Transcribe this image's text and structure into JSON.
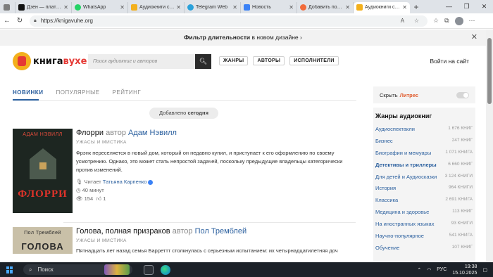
{
  "browser": {
    "tabs": [
      {
        "label": "",
        "color": "#7d7d7d",
        "active": false
      },
      {
        "label": "Дзен — платф...",
        "color": "#111111",
        "active": false
      },
      {
        "label": "WhatsApp",
        "color": "#25d366",
        "active": false
      },
      {
        "label": "Аудиокниги сл...",
        "color": "#f3b01c",
        "active": false
      },
      {
        "label": "Telegram Web",
        "color": "#2aa1da",
        "active": false
      },
      {
        "label": "Новость",
        "color": "#3b82f6",
        "active": false
      },
      {
        "label": "Добавить пост...",
        "color": "#f26b3a",
        "active": false
      },
      {
        "label": "Аудиокниги сл...",
        "color": "#f3b01c",
        "active": true
      }
    ],
    "url": "https://knigavuhe.org",
    "new_tab": "+",
    "window_controls": {
      "minimize": "—",
      "maximize": "❐",
      "close": "✕"
    }
  },
  "banner": {
    "bold": "Фильтр длительности",
    "rest": " в новом дизайне",
    "arrow": "›",
    "close": "✕"
  },
  "header": {
    "logo_main": "книга",
    "logo_accent": "вухе",
    "search_placeholder": "Поиск аудиокниг и авторов",
    "nav": [
      "ЖАНРЫ",
      "АВТОРЫ",
      "ИСПОЛНИТЕЛИ"
    ],
    "login": "Войти на сайт"
  },
  "main": {
    "tabs": [
      "НОВИНКИ",
      "ПОПУЛЯРНЫЕ",
      "РЕЙТИНГ"
    ],
    "added_label": "Добавлено",
    "added_day": "сегодня",
    "books": [
      {
        "cover_author": "АДАМ НЭВИЛЛ",
        "cover_title": "ФЛОРРИ",
        "title": "Флорри",
        "by": "автор",
        "author": "Адам Нэвилл",
        "genre": "УЖАСЫ И МИСТИКА",
        "description": "Фрэнк переселяется в новый дом, который он недавно купил, и приступает к его оформлению по своему усмотрению. Однако, это может стать непростой задачей, поскольку предыдущие владельцы категорически против изменений.",
        "reader_label": "Читает",
        "reader": "Татьяна Карпенко",
        "duration": "40 минут",
        "views": "154",
        "likes": "1"
      },
      {
        "cover_author": "Пол Тремблей",
        "cover_title": "ГОЛОВА",
        "title": "Голова, полная призраков",
        "by": "автор",
        "author": "Пол Тремблей",
        "genre": "УЖАСЫ И МИСТИКА",
        "description": "Пятнадцать лет назад семья Барреттт столкнулась с серьезным испытанием: их четырнадцатилетняя доч"
      }
    ]
  },
  "sidebar": {
    "hide_label": "Скрыть",
    "hide_brand": "Литрес",
    "genres_title": "Жанры аудиокниг",
    "genres": [
      {
        "name": "Аудиоспектакли",
        "count": "1 676 КНИГ"
      },
      {
        "name": "Бизнес",
        "count": "247 КНИГ"
      },
      {
        "name": "Биографии и мемуары",
        "count": "1 071 КНИГА"
      },
      {
        "name": "Детективы и триллеры",
        "count": "6 660 КНИГ"
      },
      {
        "name": "Для детей и Аудиосказки",
        "count": "3 124 КНИГИ"
      },
      {
        "name": "История",
        "count": "964 КНИГИ"
      },
      {
        "name": "Классика",
        "count": "2 691 КНИГА"
      },
      {
        "name": "Медицина и здоровье",
        "count": "113 КНИГ"
      },
      {
        "name": "На иностранных языках",
        "count": "93 КНИГИ"
      },
      {
        "name": "Научно-популярное",
        "count": "541 КНИГА"
      },
      {
        "name": "Обучение",
        "count": "107 КНИГ"
      }
    ]
  },
  "taskbar": {
    "search": "Поиск",
    "lang": "РУС",
    "time": "19:38",
    "date": "15.10.2025"
  }
}
